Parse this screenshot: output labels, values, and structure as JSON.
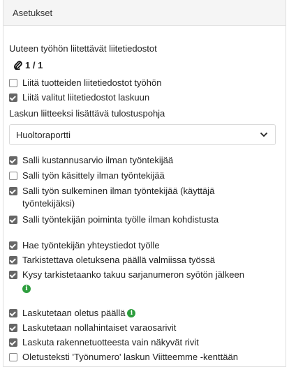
{
  "header": {
    "title": "Asetukset"
  },
  "attachments": {
    "section_label": "Uuteen työhön liitettävät liitetiedostot",
    "count": "1 / 1",
    "icon": "paperclip-icon"
  },
  "checkboxes_group1": [
    {
      "label": "Liitä tuotteiden liitetiedostot työhön",
      "checked": false
    },
    {
      "label": "Liitä valitut liitetiedostot laskuun",
      "checked": true
    }
  ],
  "print_template": {
    "label": "Laskun liitteeksi lisättävä tulostuspohja",
    "selected": "Huoltoraportti"
  },
  "checkboxes_group2": [
    {
      "label": "Salli kustannusarvio ilman työntekijää",
      "checked": true
    },
    {
      "label": "Salli työn käsittely ilman työntekijää",
      "checked": false
    },
    {
      "label": "Salli työn sulkeminen ilman työntekijää (käyttäjä työntekijäksi)",
      "checked": true
    },
    {
      "label": "Salli työntekijän poiminta työlle ilman kohdistusta",
      "checked": true
    }
  ],
  "checkboxes_group3": [
    {
      "label": "Hae työntekijän yhteystiedot työlle",
      "checked": true
    },
    {
      "label": "Tarkistettava oletuksena päällä valmiissa työssä",
      "checked": true
    },
    {
      "label": "Kysy tarkistetaanko takuu sarjanumeron syötön jälkeen",
      "checked": true,
      "info": "i"
    }
  ],
  "checkboxes_group4": [
    {
      "label": "Laskutetaan oletus päällä",
      "checked": true,
      "info": "i"
    },
    {
      "label": "Laskutetaan nollahintaiset varaosarivit",
      "checked": true
    },
    {
      "label": "Laskuta rakennetuotteesta vain näkyvät rivit",
      "checked": true
    },
    {
      "label": "Oletusteksti 'Työnumero' laskun Viitteemme -kenttään",
      "checked": false
    }
  ],
  "colors": {
    "info_badge": "#2e9e3e",
    "checkbox_checked": "#666666",
    "header_bg": "#f5f5f5"
  }
}
